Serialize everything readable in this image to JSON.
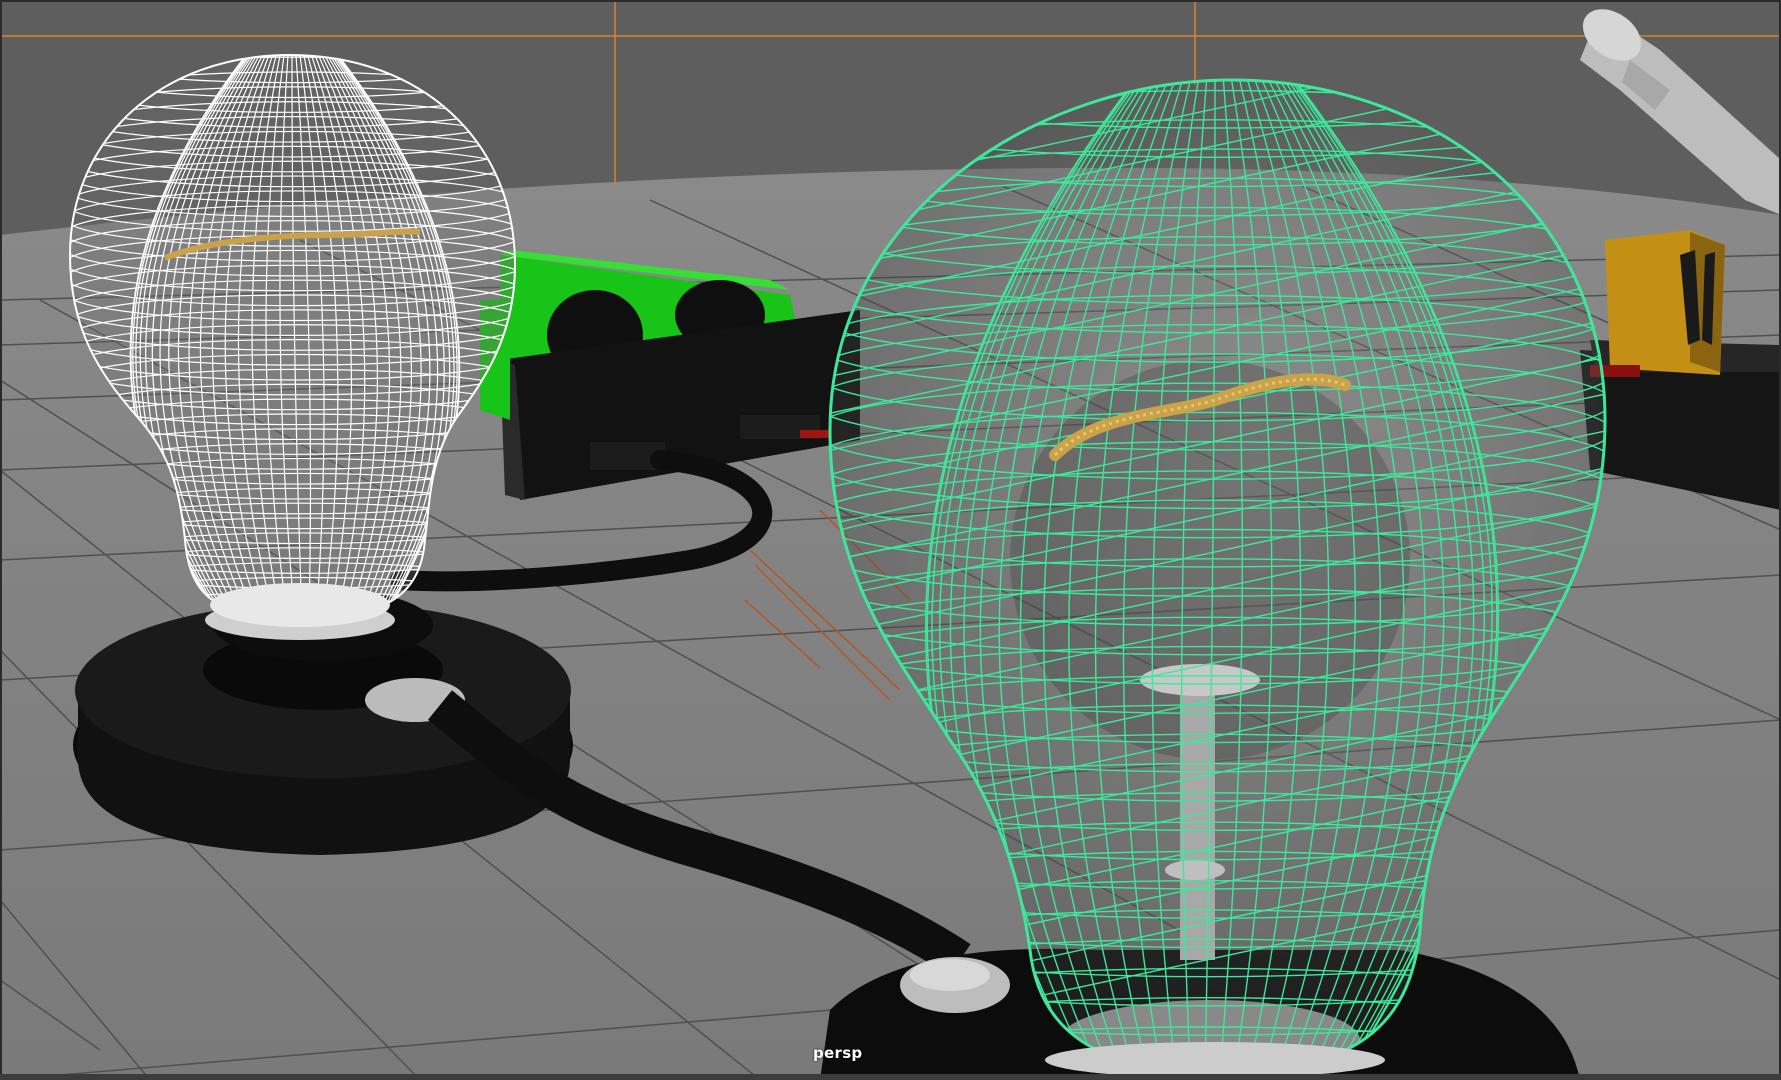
{
  "viewport": {
    "camera_label": "persp",
    "background_color": "#5e5e5e",
    "ground_color": "#7c7c7c",
    "grid_color": "#4f4f4f",
    "selection_wireframe_color": "#3ee89a",
    "unselected_wireframe_color": "#ffffff",
    "battery_color": "#19c419",
    "guide_line_color": "#d8842a"
  },
  "scene_objects": [
    {
      "name": "lightbulb-left",
      "display": "wireframe",
      "selected": false
    },
    {
      "name": "lightbulb-right",
      "display": "wireframe",
      "selected": true
    },
    {
      "name": "battery-holder",
      "display": "shaded"
    },
    {
      "name": "switch",
      "display": "shaded"
    },
    {
      "name": "wire",
      "display": "shaded"
    }
  ]
}
